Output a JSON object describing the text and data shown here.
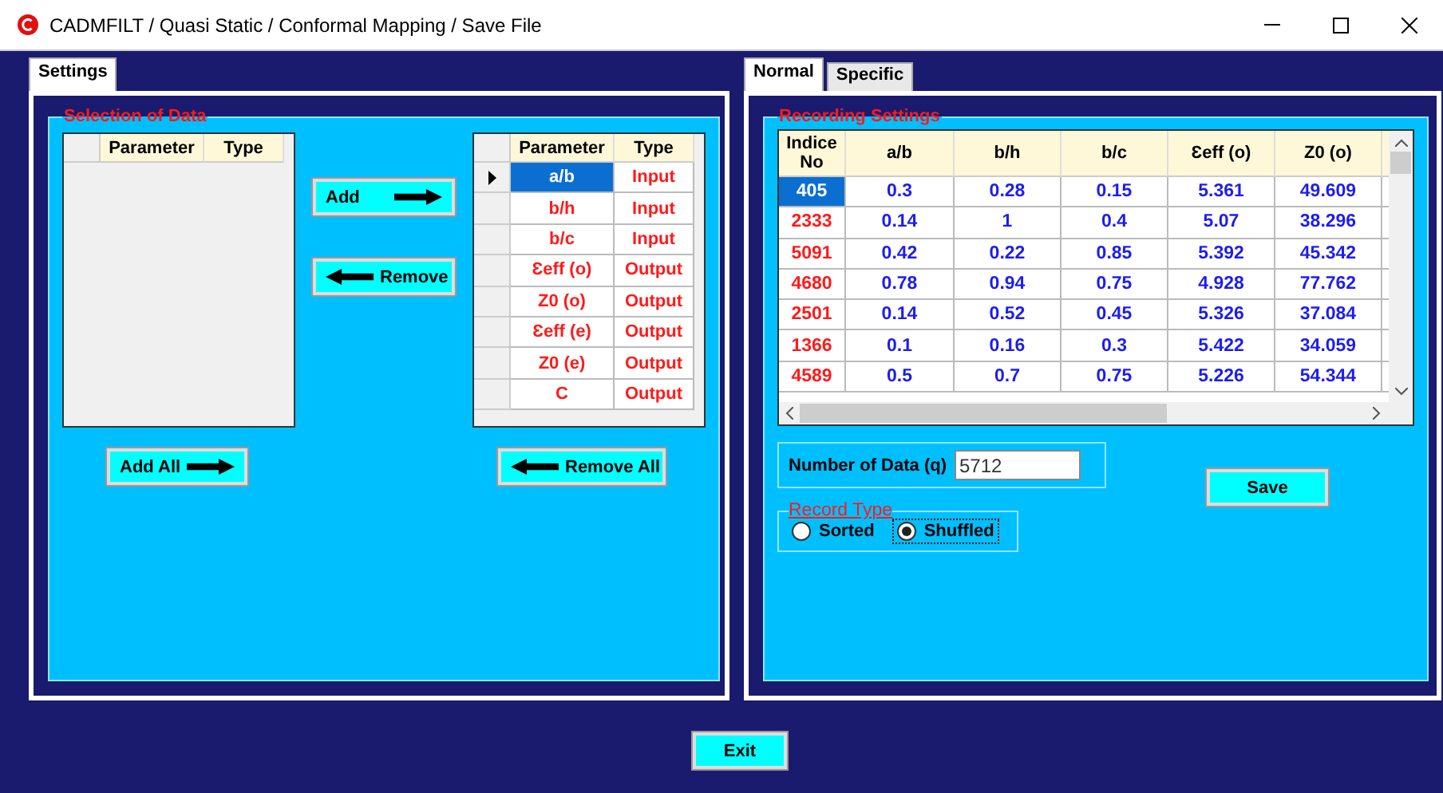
{
  "window": {
    "title": "CADMFILT / Quasi Static / Conformal Mapping / Save File"
  },
  "left_tabs": [
    {
      "label": "Settings",
      "selected": true
    }
  ],
  "selection": {
    "title": "Selection of Data",
    "available": {
      "columns": [
        "Parameter",
        "Type"
      ]
    },
    "chosen": {
      "columns": [
        "Parameter",
        "Type"
      ],
      "rows": [
        {
          "parameter": "a/b",
          "type": "Input",
          "selected": true
        },
        {
          "parameter": "b/h",
          "type": "Input",
          "selected": false
        },
        {
          "parameter": "b/c",
          "type": "Input",
          "selected": false
        },
        {
          "parameter": "Ɛeff (o)",
          "type": "Output",
          "selected": false
        },
        {
          "parameter": "Z0 (o)",
          "type": "Output",
          "selected": false
        },
        {
          "parameter": "Ɛeff (e)",
          "type": "Output",
          "selected": false
        },
        {
          "parameter": "Z0 (e)",
          "type": "Output",
          "selected": false
        },
        {
          "parameter": "C",
          "type": "Output",
          "selected": false
        }
      ]
    },
    "add": {
      "label": "Add",
      "kind": "right"
    },
    "remove": {
      "label": "Remove",
      "kind": "left"
    },
    "add_all": {
      "label": "Add All",
      "kind": "right"
    },
    "remove_all": {
      "label": "Remove All",
      "kind": "left"
    }
  },
  "right_tabs": [
    {
      "label": "Normal",
      "selected": true
    },
    {
      "label": "Specific",
      "selected": false
    }
  ],
  "recording": {
    "title": "Recording Settings",
    "columns": [
      "Indice No",
      "a/b",
      "b/h",
      "b/c",
      "Ɛeff (o)",
      "Z0 (o)"
    ],
    "rows": [
      {
        "cells": [
          "405",
          "0.3",
          "0.28",
          "0.15",
          "5.361",
          "49.609"
        ],
        "selected": true
      },
      {
        "cells": [
          "2333",
          "0.14",
          "1",
          "0.4",
          "5.07",
          "38.296"
        ],
        "selected": false
      },
      {
        "cells": [
          "5091",
          "0.42",
          "0.22",
          "0.85",
          "5.392",
          "45.342"
        ],
        "selected": false
      },
      {
        "cells": [
          "4680",
          "0.78",
          "0.94",
          "0.75",
          "4.928",
          "77.762"
        ],
        "selected": false
      },
      {
        "cells": [
          "2501",
          "0.14",
          "0.52",
          "0.45",
          "5.326",
          "37.084"
        ],
        "selected": false
      },
      {
        "cells": [
          "1366",
          "0.1",
          "0.16",
          "0.3",
          "5.422",
          "34.059"
        ],
        "selected": false
      },
      {
        "cells": [
          "4589",
          "0.5",
          "0.7",
          "0.75",
          "5.226",
          "54.344"
        ],
        "selected": false
      }
    ],
    "number_of_data": {
      "label": "Number of Data (q)",
      "value": "5712"
    },
    "record_type": {
      "title": "Record Type",
      "options": [
        {
          "label": "Sorted",
          "selected": false
        },
        {
          "label": "Shuffled",
          "selected": true
        }
      ]
    },
    "save": "Save"
  },
  "exit": "Exit"
}
